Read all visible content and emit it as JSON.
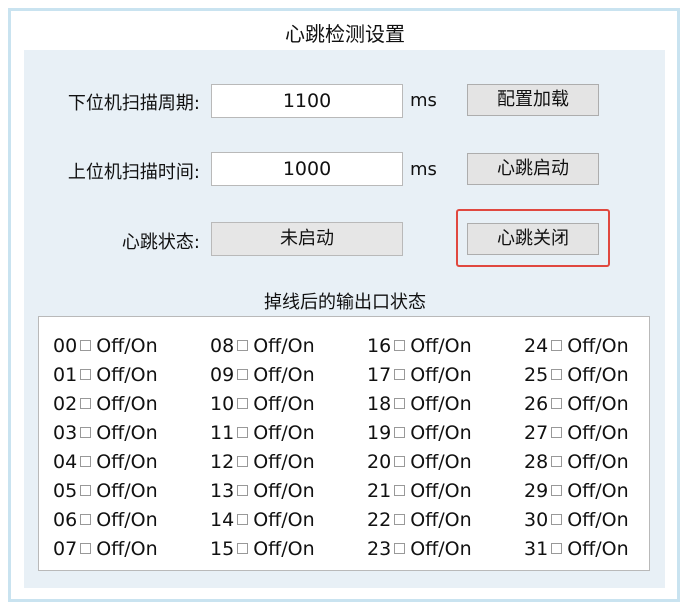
{
  "window": {
    "title": "心跳检测设置"
  },
  "settings": {
    "scan_period_label": "下位机扫描周期:",
    "scan_period_value": "1100",
    "scan_period_unit": "ms",
    "upper_scan_label": "上位机扫描时间:",
    "upper_scan_value": "1000",
    "upper_scan_unit": "ms",
    "status_label": "心跳状态:",
    "status_value": "未启动"
  },
  "buttons": {
    "load_config": "配置加载",
    "start_heartbeat": "心跳启动",
    "stop_heartbeat": "心跳关闭"
  },
  "offline_section": {
    "title": "掉线后的输出口状态",
    "items": [
      {
        "num": "00",
        "label": "Off/On"
      },
      {
        "num": "01",
        "label": "Off/On"
      },
      {
        "num": "02",
        "label": "Off/On"
      },
      {
        "num": "03",
        "label": "Off/On"
      },
      {
        "num": "04",
        "label": "Off/On"
      },
      {
        "num": "05",
        "label": "Off/On"
      },
      {
        "num": "06",
        "label": "Off/On"
      },
      {
        "num": "07",
        "label": "Off/On"
      },
      {
        "num": "08",
        "label": "Off/On"
      },
      {
        "num": "09",
        "label": "Off/On"
      },
      {
        "num": "10",
        "label": "Off/On"
      },
      {
        "num": "11",
        "label": "Off/On"
      },
      {
        "num": "12",
        "label": "Off/On"
      },
      {
        "num": "13",
        "label": "Off/On"
      },
      {
        "num": "14",
        "label": "Off/On"
      },
      {
        "num": "15",
        "label": "Off/On"
      },
      {
        "num": "16",
        "label": "Off/On"
      },
      {
        "num": "17",
        "label": "Off/On"
      },
      {
        "num": "18",
        "label": "Off/On"
      },
      {
        "num": "19",
        "label": "Off/On"
      },
      {
        "num": "20",
        "label": "Off/On"
      },
      {
        "num": "21",
        "label": "Off/On"
      },
      {
        "num": "22",
        "label": "Off/On"
      },
      {
        "num": "23",
        "label": "Off/On"
      },
      {
        "num": "24",
        "label": "Off/On"
      },
      {
        "num": "25",
        "label": "Off/On"
      },
      {
        "num": "26",
        "label": "Off/On"
      },
      {
        "num": "27",
        "label": "Off/On"
      },
      {
        "num": "28",
        "label": "Off/On"
      },
      {
        "num": "29",
        "label": "Off/On"
      },
      {
        "num": "30",
        "label": "Off/On"
      },
      {
        "num": "31",
        "label": "Off/On"
      }
    ]
  },
  "colors": {
    "highlight": "#e0483f",
    "panel_bg": "#e8f0f6",
    "frame": "#c9e3f0"
  }
}
